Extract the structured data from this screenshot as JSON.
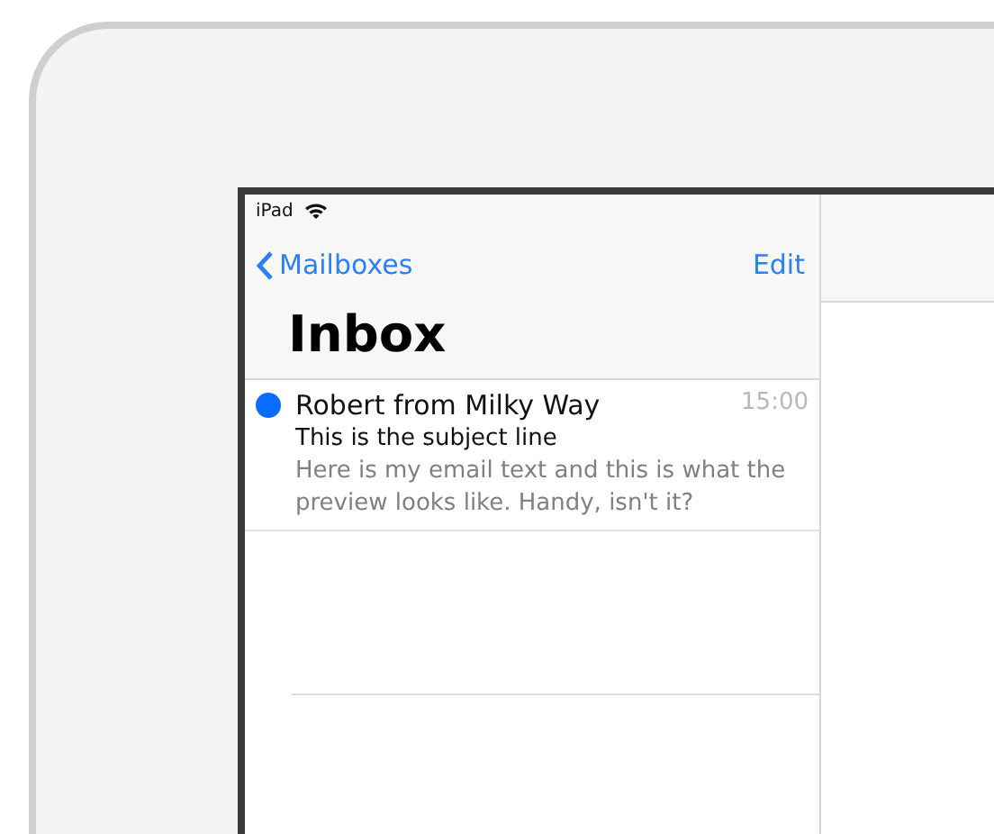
{
  "status_bar": {
    "device": "iPad"
  },
  "nav": {
    "back": "Mailboxes",
    "action": "Edit",
    "title": "Inbox"
  },
  "messages": [
    {
      "sender": "Robert from Milky Way",
      "time": "15:00",
      "subject": "This is the subject line",
      "preview": "Here is my email text and this is what the preview looks like. Handy, isn't it?",
      "unread": true
    }
  ]
}
